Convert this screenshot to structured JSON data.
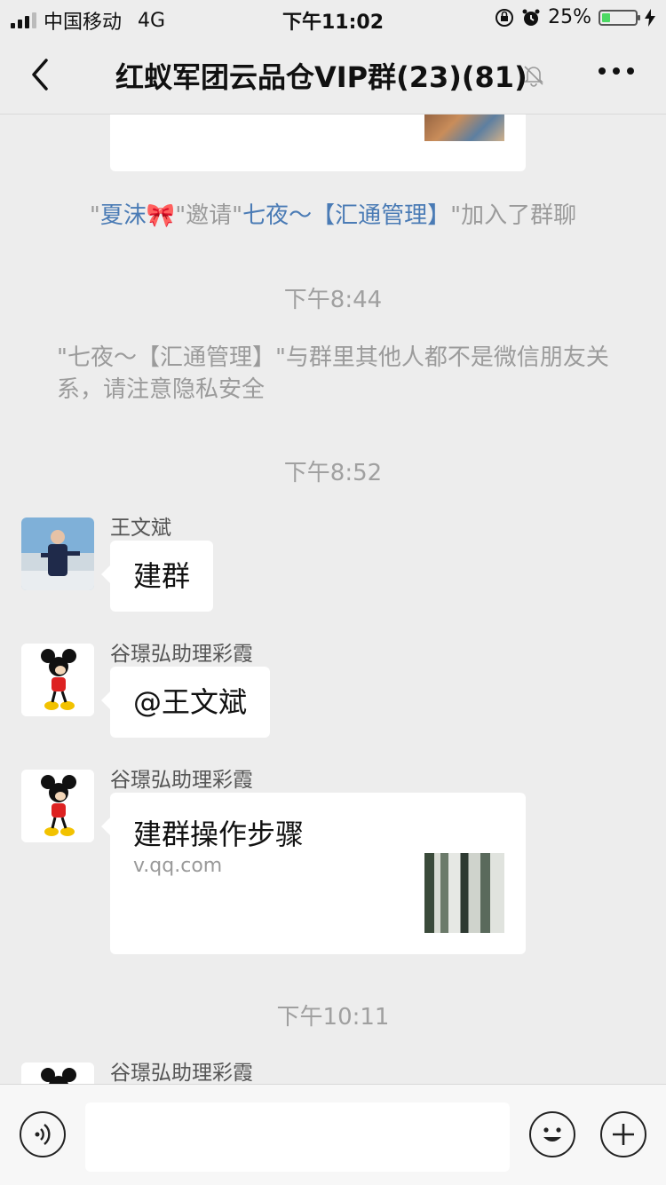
{
  "status_bar": {
    "carrier": "中国移动",
    "network": "4G",
    "time": "下午11:02",
    "battery_percent": "25%",
    "battery_level": 0.25
  },
  "nav": {
    "title": "红蚁军团云品仓VIP群(23)(81)",
    "icons": [
      "back-chevron-icon",
      "mute-bell-icon",
      "more-dots-icon"
    ]
  },
  "chat": {
    "join_notice": {
      "quote1": "\"",
      "inviter": "夏沫🎀",
      "mid": "\"邀请\"",
      "invitee": "七夜～【汇通管理】",
      "end": "\"加入了群聊"
    },
    "time1": "下午8:44",
    "privacy_notice": "\"七夜～【汇通管理】\"与群里其他人都不是微信朋友关系，请注意隐私安全",
    "time2": "下午8:52",
    "messages": [
      {
        "sender": "王文斌",
        "text": "建群"
      },
      {
        "sender": "谷璟弘助理彩霞",
        "text": "@王文斌"
      },
      {
        "sender": "谷璟弘助理彩霞",
        "link_title": "建群操作步骤",
        "link_source": "v.qq.com"
      }
    ],
    "time3": "下午10:11",
    "last_sender": "谷璟弘助理彩霞"
  },
  "input_bar": {
    "value": "",
    "icons": [
      "voice-icon",
      "emoji-icon",
      "plus-icon"
    ]
  }
}
